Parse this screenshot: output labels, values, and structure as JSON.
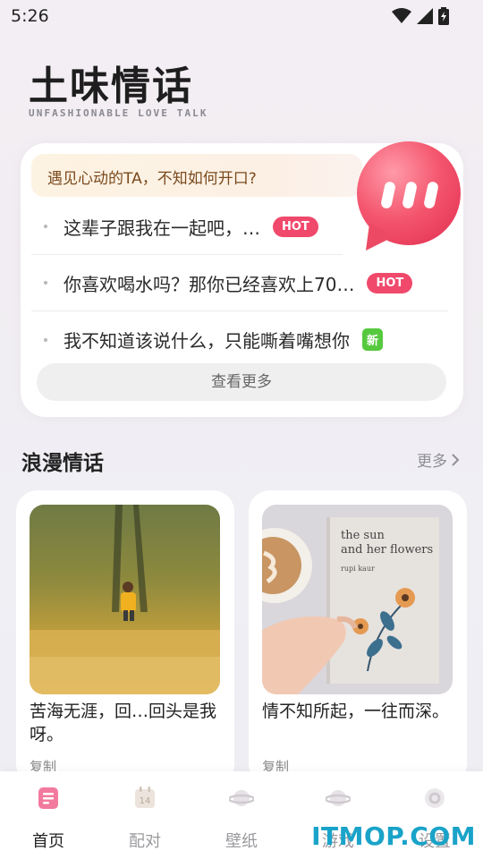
{
  "status_bar": {
    "time": "5:26"
  },
  "header": {
    "title": "土味情话",
    "subtitle": "UNFASHIONABLE LOVE TALK"
  },
  "talk_card": {
    "banner": "遇见心动的TA，不知如何开口?",
    "items": [
      {
        "text": "这辈子跟我在一起吧，…",
        "badge": "HOT"
      },
      {
        "text": "你喜欢喝水吗？那你已经喜欢上70…",
        "badge": "HOT"
      },
      {
        "text": "我不知道该说什么，只能嘶着嘴想你",
        "badge": "新"
      }
    ],
    "more_button": "查看更多"
  },
  "romance_section": {
    "title": "浪漫情话",
    "more": "更多",
    "cards": [
      {
        "text": "苦海无涯，回…回头是我呀。",
        "copy": "复制"
      },
      {
        "text": "情不知所起，一往而深。",
        "copy": "复制",
        "book_title_line1": "the sun",
        "book_title_line2": "and her flowers",
        "book_author": "rupi kaur"
      }
    ]
  },
  "bottom_nav": {
    "items": [
      {
        "label": "首页"
      },
      {
        "label": "配对"
      },
      {
        "label": "壁纸"
      },
      {
        "label": "游戏"
      },
      {
        "label": "设置"
      }
    ]
  },
  "watermark": "ITMOP.COM",
  "colors": {
    "hot_badge": "#f0496b",
    "new_badge": "#56c93e",
    "bubble": "#f1566f",
    "watermark": "#1aa3c9"
  }
}
